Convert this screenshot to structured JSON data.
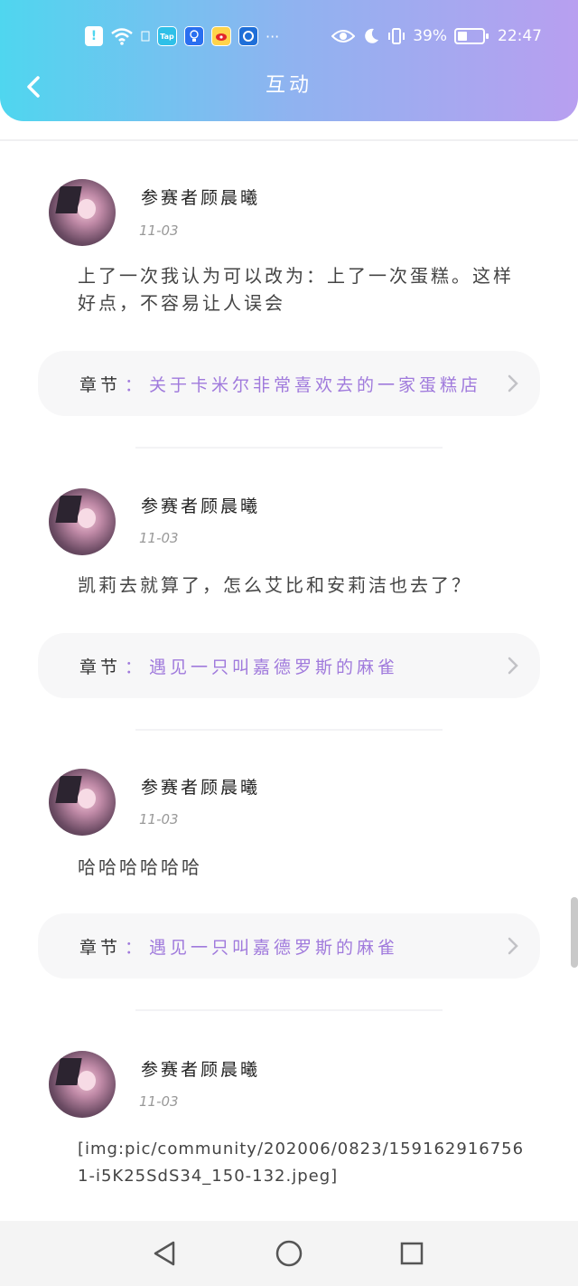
{
  "statusbar": {
    "notif": "!",
    "apps": [
      "Tap",
      "",
      "",
      ""
    ],
    "more": "···",
    "battery_text": "39%",
    "battery_level": 0.39,
    "time": "22:47"
  },
  "header": {
    "title": "互动"
  },
  "posts": [
    {
      "username": "参赛者顾晨曦",
      "date": "11-03",
      "text": "上了一次我认为可以改为：上了一次蛋糕。这样好点，不容易让人误会",
      "chapter_key": "章节",
      "chapter_colon": "：",
      "chapter_name": "关于卡米尔非常喜欢去的一家蛋糕店"
    },
    {
      "username": "参赛者顾晨曦",
      "date": "11-03",
      "text": "凯莉去就算了，怎么艾比和安莉洁也去了？",
      "chapter_key": "章节",
      "chapter_colon": "：",
      "chapter_name": "遇见一只叫嘉德罗斯的麻雀"
    },
    {
      "username": "参赛者顾晨曦",
      "date": "11-03",
      "text": "哈哈哈哈哈哈",
      "chapter_key": "章节",
      "chapter_colon": "：",
      "chapter_name": "遇见一只叫嘉德罗斯的麻雀"
    },
    {
      "username": "参赛者顾晨曦",
      "date": "11-03",
      "text": "[img:pic/community/202006/0823/1591629167561-i5K25SdS34_150-132.jpeg]"
    }
  ],
  "icons": {
    "back": "chevron-left-icon",
    "chapter_arrow": "chevron-right-icon",
    "nav": [
      "back-triangle-icon",
      "home-circle-icon",
      "recents-square-icon"
    ]
  }
}
